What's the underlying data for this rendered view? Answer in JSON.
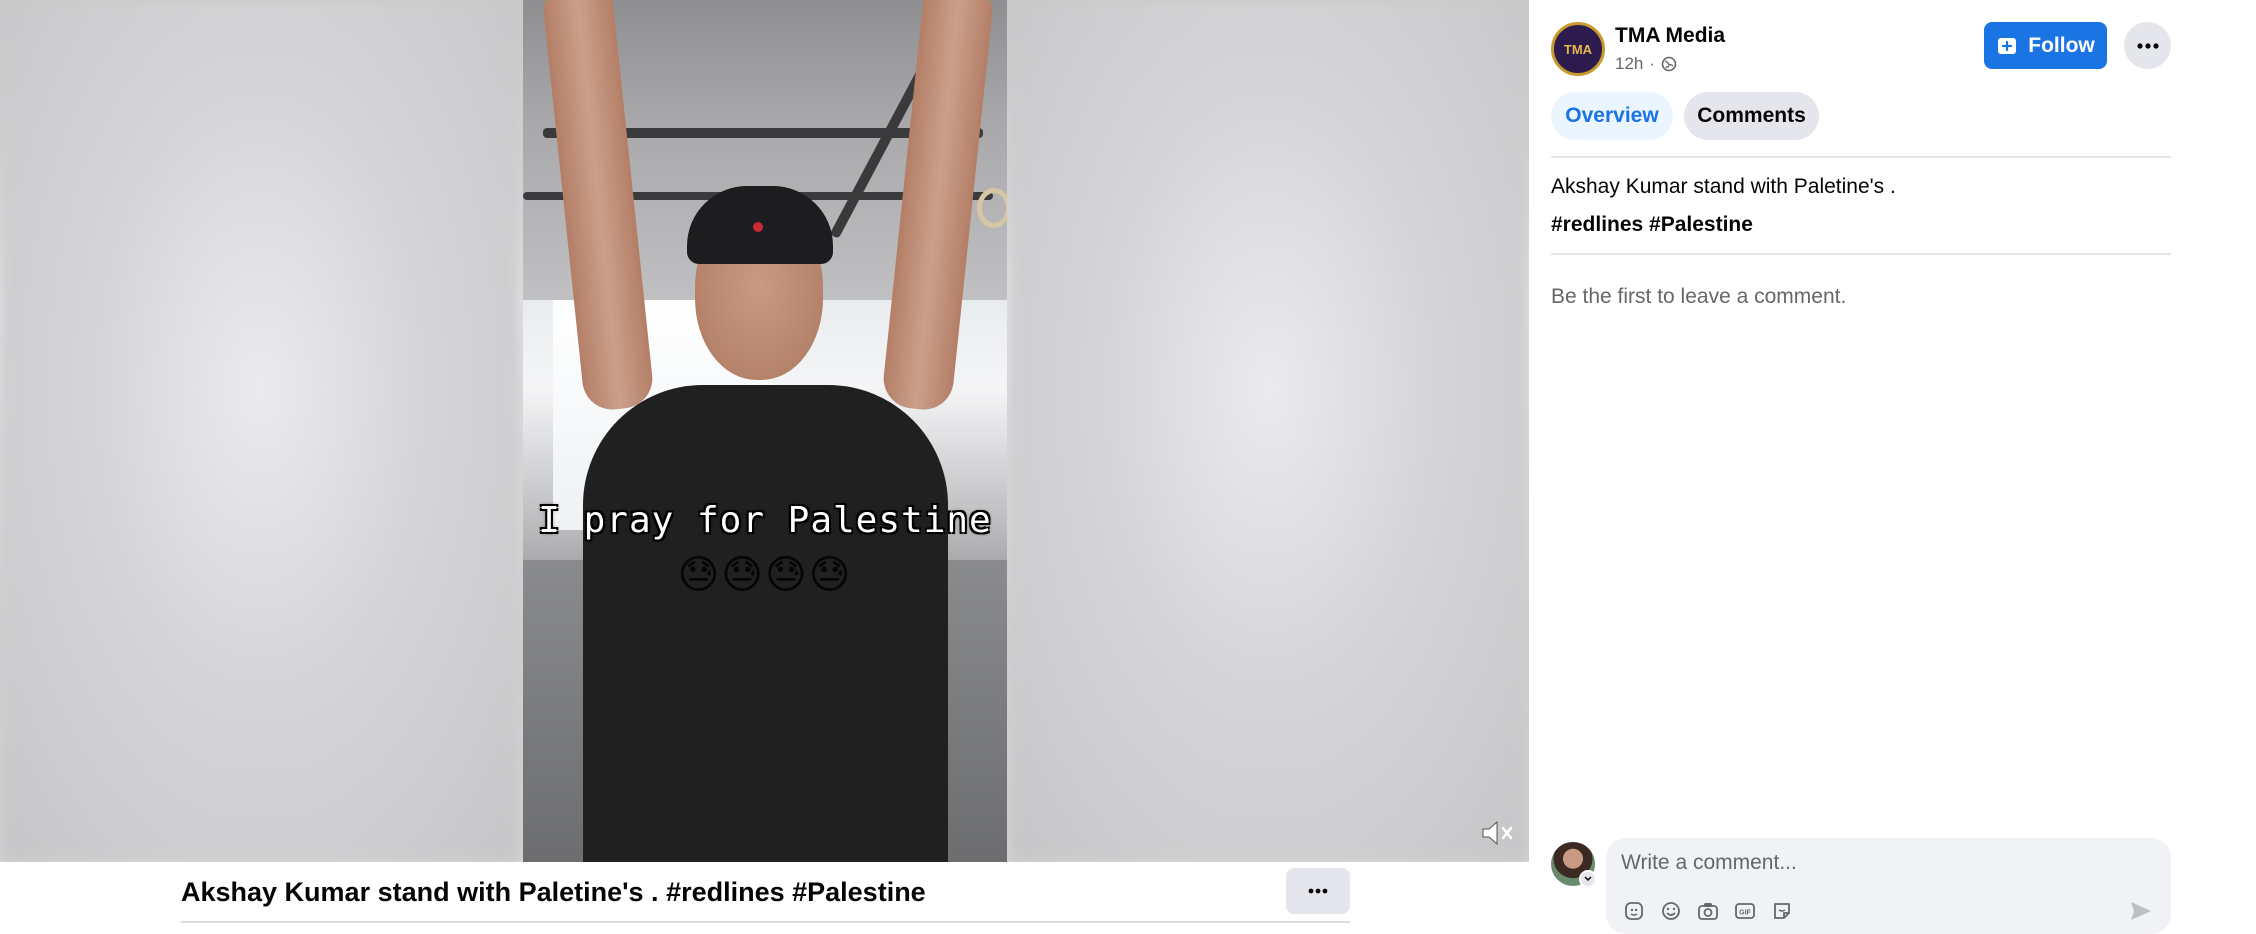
{
  "video": {
    "caption_line": "I pray for Palestine",
    "caption_emojis": "😓😓😓😓"
  },
  "post_title": "Akshay Kumar stand with Paletine's . #redlines #Palestine",
  "panel": {
    "page_name": "TMA Media",
    "page_avatar_text": "TMA",
    "time_ago": "12h",
    "meta_separator": "·",
    "follow_label": "Follow",
    "tabs": [
      {
        "label": "Overview",
        "active": true
      },
      {
        "label": "Comments",
        "active": false
      }
    ],
    "post_text": "Akshay Kumar stand with Paletine's .",
    "post_tags": "#redlines #Palestine",
    "empty_comments": "Be the first to leave a comment.",
    "comment_placeholder": "Write a comment...",
    "comment_value": ""
  },
  "colors": {
    "accent": "#1b74e4",
    "tab_active_bg": "#ebf5ff",
    "button_gray": "#e4e6eb",
    "secondary_text": "#65676b"
  },
  "icons": [
    "mute-icon",
    "more-horizontal-icon",
    "globe-icon",
    "follow-page-icon",
    "avatar-sticker-icon",
    "emoji-icon",
    "camera-icon",
    "gif-icon",
    "sticker-icon",
    "send-icon",
    "chevron-down-icon"
  ]
}
